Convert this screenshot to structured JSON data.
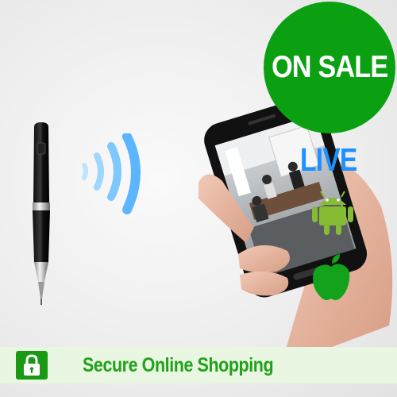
{
  "badge": {
    "label": "ON SALE",
    "color": "#0aa012"
  },
  "live_label": "LIVE",
  "footer": {
    "secure_label": "Secure Online Shopping",
    "color": "#22a11a"
  },
  "icons": [
    "spy-pen",
    "wifi-signal",
    "smartphone",
    "android",
    "apple",
    "lock"
  ]
}
